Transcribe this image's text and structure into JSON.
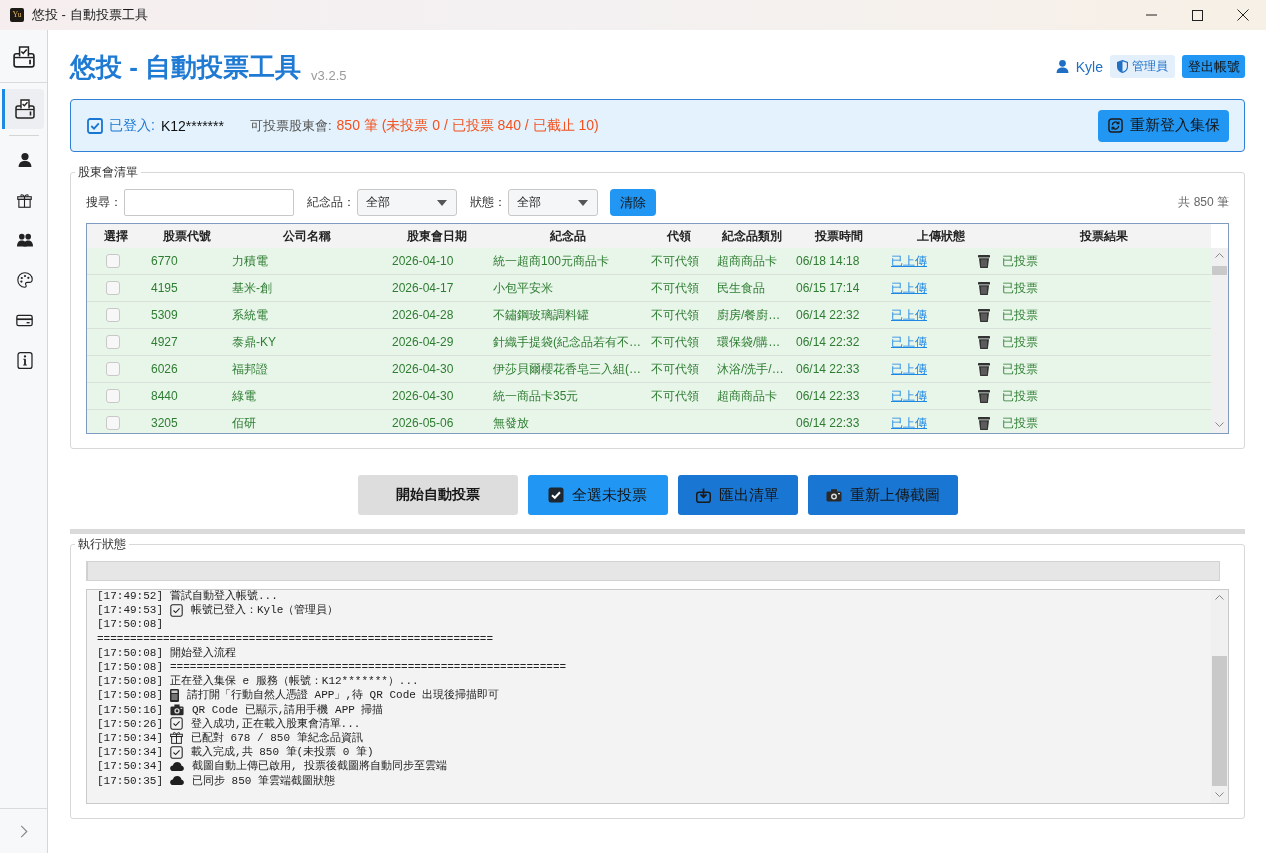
{
  "window": {
    "icon_text": "Yu",
    "title": "悠投 - 自動投票工具"
  },
  "sidebar": {
    "items": [
      {
        "selected": true
      },
      {
        "selected": false
      },
      {
        "selected": false
      },
      {
        "selected": false
      },
      {
        "selected": false
      },
      {
        "selected": false
      },
      {
        "selected": false
      }
    ]
  },
  "header": {
    "title": "悠投 - 自動投票工具",
    "version": "v3.2.5",
    "user": "Kyle",
    "role": "管理員",
    "logout_button": "登出帳號"
  },
  "login_banner": {
    "status": "已登入:",
    "account": "K12*******",
    "summary_label": "可投票股東會:",
    "summary": "850 筆 (未投票 0 / 已投票 840 / 已截止 10)",
    "relogin_button": "重新登入集保"
  },
  "meeting_list": {
    "legend": "股東會清單",
    "search_label": "搜尋：",
    "gift_label": "紀念品：",
    "gift_filter": "全部",
    "status_label": "狀態：",
    "status_filter": "全部",
    "clear_button": "清除",
    "total": "共 850 筆",
    "columns": [
      "選擇",
      "股票代號",
      "公司名稱",
      "股東會日期",
      "紀念品",
      "代領",
      "紀念品類別",
      "投票時間",
      "上傳狀態",
      "投票結果"
    ],
    "rows": [
      {
        "checked": false,
        "voted": true,
        "code": "6770",
        "company": "力積電",
        "date": "2026-04-10",
        "gift": "統一超商100元商品卡",
        "proxy": "不可代領",
        "category": "超商商品卡",
        "vote_time": "06/18 14:18",
        "upload": "已上傳",
        "result": "已投票"
      },
      {
        "checked": false,
        "voted": true,
        "code": "4195",
        "company": "基米-創",
        "date": "2026-04-17",
        "gift": "小包平安米",
        "proxy": "不可代領",
        "category": "民生食品",
        "vote_time": "06/15 17:14",
        "upload": "已上傳",
        "result": "已投票"
      },
      {
        "checked": false,
        "voted": true,
        "code": "5309",
        "company": "系統電",
        "date": "2026-04-28",
        "gift": "不鏽鋼玻璃調料罐",
        "proxy": "不可代領",
        "category": "廚房/餐廚…",
        "vote_time": "06/14 22:32",
        "upload": "已上傳",
        "result": "已投票"
      },
      {
        "checked": false,
        "voted": true,
        "code": "4927",
        "company": "泰鼎-KY",
        "date": "2026-04-29",
        "gift": "針織手提袋(紀念品若有不…",
        "proxy": "不可代領",
        "category": "環保袋/購…",
        "vote_time": "06/14 22:32",
        "upload": "已上傳",
        "result": "已投票"
      },
      {
        "checked": false,
        "voted": true,
        "code": "6026",
        "company": "福邦證",
        "date": "2026-04-30",
        "gift": "伊莎貝爾櫻花香皂三入組(…",
        "proxy": "不可代領",
        "category": "沐浴/洗手/…",
        "vote_time": "06/14 22:33",
        "upload": "已上傳",
        "result": "已投票"
      },
      {
        "checked": false,
        "voted": true,
        "code": "8440",
        "company": "綠電",
        "date": "2026-04-30",
        "gift": "統一商品卡35元",
        "proxy": "不可代領",
        "category": "超商商品卡",
        "vote_time": "06/14 22:33",
        "upload": "已上傳",
        "result": "已投票"
      },
      {
        "checked": false,
        "voted": true,
        "code": "3205",
        "company": "佰研",
        "date": "2026-05-06",
        "gift": "無發放",
        "vote_time": "06/14 22:33",
        "upload": "已上傳",
        "result": "已投票"
      }
    ]
  },
  "actions": [
    {
      "kind": "start",
      "label": "開始自動投票"
    },
    {
      "kind": "select",
      "label": "全選未投票"
    },
    {
      "kind": "export",
      "label": "匯出清單"
    },
    {
      "kind": "upload",
      "label": "重新上傳截圖"
    }
  ],
  "log_panel": {
    "legend": "執行狀態",
    "progress": {
      "level": 0
    },
    "lines": [
      {
        "time": "[17:49:52]",
        "kind": "plain",
        "text": "嘗試自動登入帳號..."
      },
      {
        "time": "[17:49:53]",
        "kind": "check",
        "text": "帳號已登入：Kyle（管理員）"
      },
      {
        "time": "[17:50:08]",
        "kind": "plain"
      },
      {
        "kind": "plain",
        "text": "============================================================"
      },
      {
        "time": "[17:50:08]",
        "kind": "plain",
        "text": "開始登入流程"
      },
      {
        "time": "[17:50:08]",
        "kind": "plain",
        "text": "============================================================"
      },
      {
        "time": "[17:50:08]",
        "kind": "plain",
        "text": "正在登入集保 e 服務（帳號：K12*******）..."
      },
      {
        "time": "[17:50:08]",
        "kind": "phone",
        "text": "請打開「行動自然人憑證 APP」,待 QR Code 出現後掃描即可"
      },
      {
        "time": "[17:50:16]",
        "kind": "camera",
        "text": "QR Code 已顯示,請用手機 APP 掃描"
      },
      {
        "time": "[17:50:26]",
        "kind": "check",
        "text": "登入成功,正在載入股東會清單..."
      },
      {
        "time": "[17:50:34]",
        "kind": "gift",
        "text": "已配對 678 / 850 筆紀念品資訊"
      },
      {
        "time": "[17:50:34]",
        "kind": "check",
        "text": "載入完成,共 850 筆(未投票 0 筆)"
      },
      {
        "time": "[17:50:34]",
        "kind": "cloud",
        "text": "截圖自動上傳已啟用, 投票後截圖將自動同步至雲端"
      },
      {
        "time": "[17:50:35]",
        "kind": "cloud",
        "text": "已同步 850 筆雲端截圖狀態"
      }
    ]
  }
}
